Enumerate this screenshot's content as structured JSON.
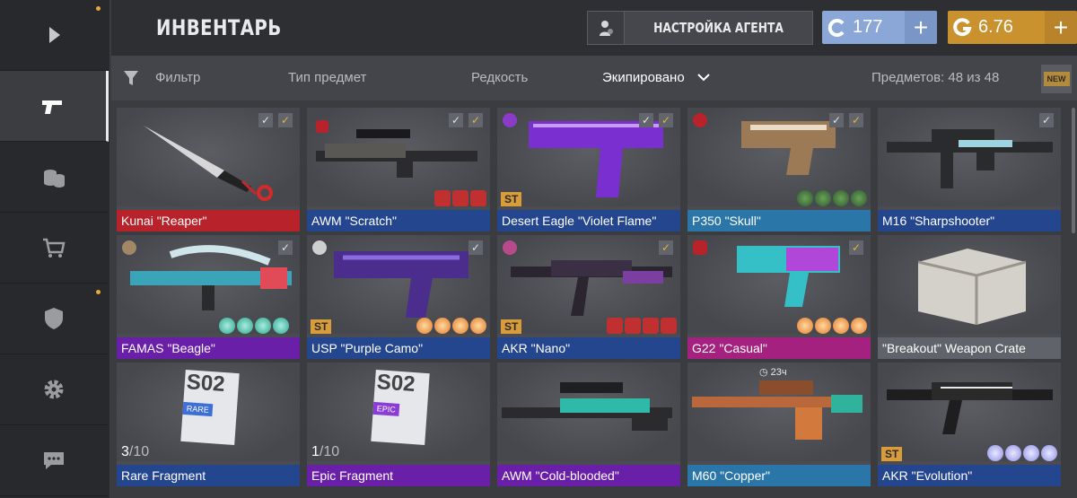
{
  "header": {
    "title": "ИНВЕНТАРЬ",
    "agent_button": "НАСТРОЙКА АГЕНТА",
    "credits": {
      "value": "177",
      "plus": "+"
    },
    "gold": {
      "value": "6.76",
      "plus": "+"
    }
  },
  "filterbar": {
    "filter": "Фильтр",
    "item_type": "Тип предмет",
    "rarity": "Редкость",
    "equipped": "Экипировано",
    "items_count": "Предметов: 48 из 48",
    "new_badge": "NEW"
  },
  "sidebar": {
    "items": [
      {
        "icon": "play-icon"
      },
      {
        "icon": "pistol-icon",
        "active": true
      },
      {
        "icon": "coins-icon"
      },
      {
        "icon": "cart-icon"
      },
      {
        "icon": "shield-icon"
      },
      {
        "icon": "gear-icon"
      },
      {
        "icon": "chat-icon"
      }
    ]
  },
  "items": [
    {
      "name": "Kunai \"Reaper\"",
      "rarity_color": "#b8232b",
      "equipped_by": [
        "gray",
        "gold"
      ]
    },
    {
      "name": "AWM \"Scratch\"",
      "rarity_color": "#24468f",
      "equipped_by": [
        "gray",
        "gold"
      ]
    },
    {
      "name": "Desert Eagle \"Violet Flame\"",
      "rarity_color": "#24468f",
      "st": "ST",
      "equipped_by": [
        "gray",
        "gold"
      ]
    },
    {
      "name": "P350 \"Skull\"",
      "rarity_color": "#2a76a8",
      "equipped_by": [
        "gray",
        "gold"
      ]
    },
    {
      "name": "M16 \"Sharpshooter\"",
      "rarity_color": "#24468f",
      "equipped_by": [
        "gray"
      ]
    },
    {
      "name": "FAMAS \"Beagle\"",
      "rarity_color": "#6a1fa8",
      "equipped_by": [
        "gray"
      ]
    },
    {
      "name": "USP \"Purple Camo\"",
      "rarity_color": "#24468f",
      "st": "ST",
      "equipped_by": [
        "gray"
      ]
    },
    {
      "name": "AKR \"Nano\"",
      "rarity_color": "#24468f",
      "st": "ST",
      "equipped_by": [
        "gold"
      ]
    },
    {
      "name": "G22 \"Casual\"",
      "rarity_color": "#a4217f",
      "equipped_by": [
        "gold"
      ]
    },
    {
      "name": "\"Breakout\" Weapon Crate",
      "rarity_color": "#60636a",
      "equipped_by": []
    },
    {
      "name": "Rare Fragment",
      "rarity_color": "#24468f",
      "count": "3",
      "count_total": "/10",
      "equipped_by": []
    },
    {
      "name": "Epic Fragment",
      "rarity_color": "#6a1fa8",
      "count": "1",
      "count_total": "/10",
      "equipped_by": []
    },
    {
      "name": "AWM \"Cold-blooded\"",
      "rarity_color": "#6a1fa8",
      "equipped_by": []
    },
    {
      "name": "M60 \"Copper\"",
      "rarity_color": "#2a76a8",
      "timer": "23ч",
      "equipped_by": []
    },
    {
      "name": "AKR \"Evolution\"",
      "rarity_color": "#24468f",
      "st": "ST",
      "equipped_by": []
    }
  ],
  "fragment_labels": {
    "season": "S02",
    "rare": "RARE",
    "epic": "EPIC"
  },
  "colors": {
    "accent_gold": "#c9922e",
    "accent_blue": "#8aa7d8",
    "check_gold": "#e9b23e"
  }
}
